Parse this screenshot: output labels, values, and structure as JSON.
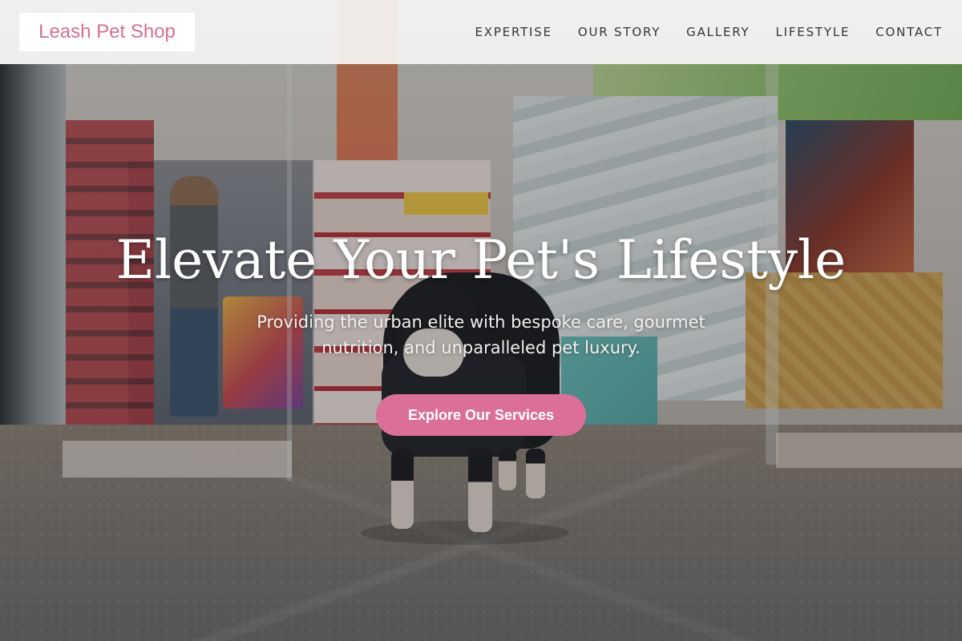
{
  "header": {
    "logo_text": "Leash Pet Shop",
    "nav": [
      {
        "label": "EXPERTISE"
      },
      {
        "label": "OUR STORY"
      },
      {
        "label": "GALLERY"
      },
      {
        "label": "LIFESTYLE"
      },
      {
        "label": "CONTACT"
      }
    ]
  },
  "hero": {
    "title": "Elevate Your Pet's Lifestyle",
    "subtitle": "Providing the urban elite with bespoke care, gourmet nutrition, and unparalleled pet luxury.",
    "cta_label": "Explore Our Services"
  },
  "colors": {
    "accent": "#dc6f97",
    "logo_text": "#d46f95",
    "header_bg": "#f5f5f4",
    "nav_text": "#353535"
  }
}
